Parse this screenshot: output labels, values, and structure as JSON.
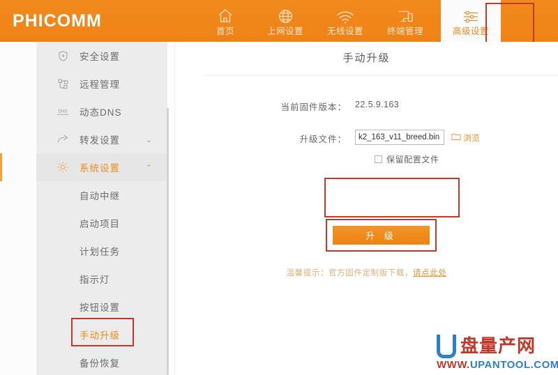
{
  "brand": {
    "logo_text": "PHICOMM",
    "header_color": "#f08519"
  },
  "nav": {
    "items": [
      {
        "label": "首页",
        "icon": "home-icon",
        "active": false
      },
      {
        "label": "上网设置",
        "icon": "globe-icon",
        "active": false
      },
      {
        "label": "无线设置",
        "icon": "wifi-icon",
        "active": false
      },
      {
        "label": "终端管理",
        "icon": "devices-icon",
        "active": false
      },
      {
        "label": "高级设置",
        "icon": "sliders-icon",
        "active": true
      }
    ],
    "highlight_color": "#c0392b"
  },
  "sidebar": {
    "items": [
      {
        "label": "安全设置",
        "icon": "shield-plus-icon",
        "chevron": "",
        "active": false
      },
      {
        "label": "远程管理",
        "icon": "remote-nodes-icon",
        "chevron": "",
        "active": false
      },
      {
        "label": "动态DNS",
        "icon": "dns-icon",
        "chevron": "",
        "active": false
      },
      {
        "label": "转发设置",
        "icon": "forward-arrow-icon",
        "chevron": "⌄",
        "active": false
      },
      {
        "label": "系统设置",
        "icon": "gear-icon",
        "chevron": "⌃",
        "active": true
      }
    ],
    "subitems": [
      {
        "label": "自动中继",
        "active": false
      },
      {
        "label": "启动项目",
        "active": false
      },
      {
        "label": "计划任务",
        "active": false
      },
      {
        "label": "指示灯",
        "active": false
      },
      {
        "label": "按钮设置",
        "active": false
      },
      {
        "label": "手动升级",
        "active": true
      },
      {
        "label": "备份恢复",
        "active": false
      }
    ]
  },
  "content": {
    "title": "手动升级",
    "firmware": {
      "label": "当前固件版本：",
      "value": "22.5.9.163"
    },
    "upgrade_file": {
      "label": "升级文件：",
      "input_value": "k2_163_v11_breed.bin",
      "input_placeholder": "",
      "browse_label": "浏览",
      "browse_icon": "folder-icon",
      "keep_config_label": "保留配置文件",
      "keep_config_checked": false
    },
    "upgrade_button": "升 级",
    "tip": {
      "prefix": "温馨提示：官方固件定制版下载，",
      "link": "请点此处"
    }
  },
  "watermark": {
    "letter": "U",
    "cn_text": "盘量产网",
    "url_www": "WWW.",
    "url_name": "UPANTOOL.COM"
  }
}
